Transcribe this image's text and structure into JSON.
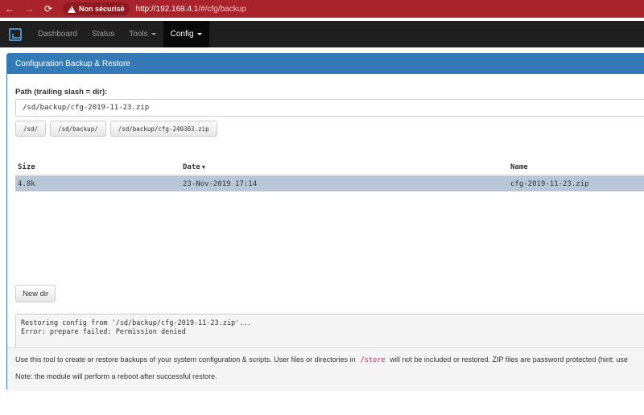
{
  "browser": {
    "back_icon": "←",
    "forward_icon": "→",
    "reload_icon": "⟳",
    "security_label": "Non sécurisé",
    "url_host": "http://192.168.4.1",
    "url_path": "/#/cfg/backup"
  },
  "navbar": {
    "items": [
      {
        "label": "Dashboard"
      },
      {
        "label": "Status"
      },
      {
        "label": "Tools"
      },
      {
        "label": "Config"
      }
    ],
    "active": "Config"
  },
  "panel": {
    "title": "Configuration Backup & Restore",
    "path_label": "Path (trailing slash = dir):",
    "path_value": "/sd/backup/cfg-2019-11-23.zip",
    "quick_paths": [
      "/sd/",
      "/sd/backup/",
      "/sd/backup/cfg-240303.zip"
    ],
    "table": {
      "headers": [
        "Size",
        "Date",
        "Name"
      ],
      "sort_arrow": "▼",
      "rows": [
        {
          "size": "4.8k",
          "date": "23-Nov-2019 17:14",
          "name": "cfg-2019-11-23.zip"
        }
      ]
    },
    "new_dir_label": "New dir",
    "log": [
      "Restoring config from '/sd/backup/cfg-2019-11-23.zip'...",
      "Error: prepare failed: Permission denied"
    ],
    "footer": {
      "line1_before": "Use this tool to create or restore backups of your system configuration & scripts. User files or directories in",
      "line1_code": "/store",
      "line1_after": "will not be included or restored. ZIP files are password protected (hint: use",
      "line2": "Note: the module will perform a reboot after successful restore."
    }
  },
  "colors": {
    "browser_bar": "#a8232b",
    "navbar": "#1f1f1f",
    "panel_primary": "#337ab7",
    "selected_row": "#b8c7d6",
    "code_red": "#c7254e"
  }
}
